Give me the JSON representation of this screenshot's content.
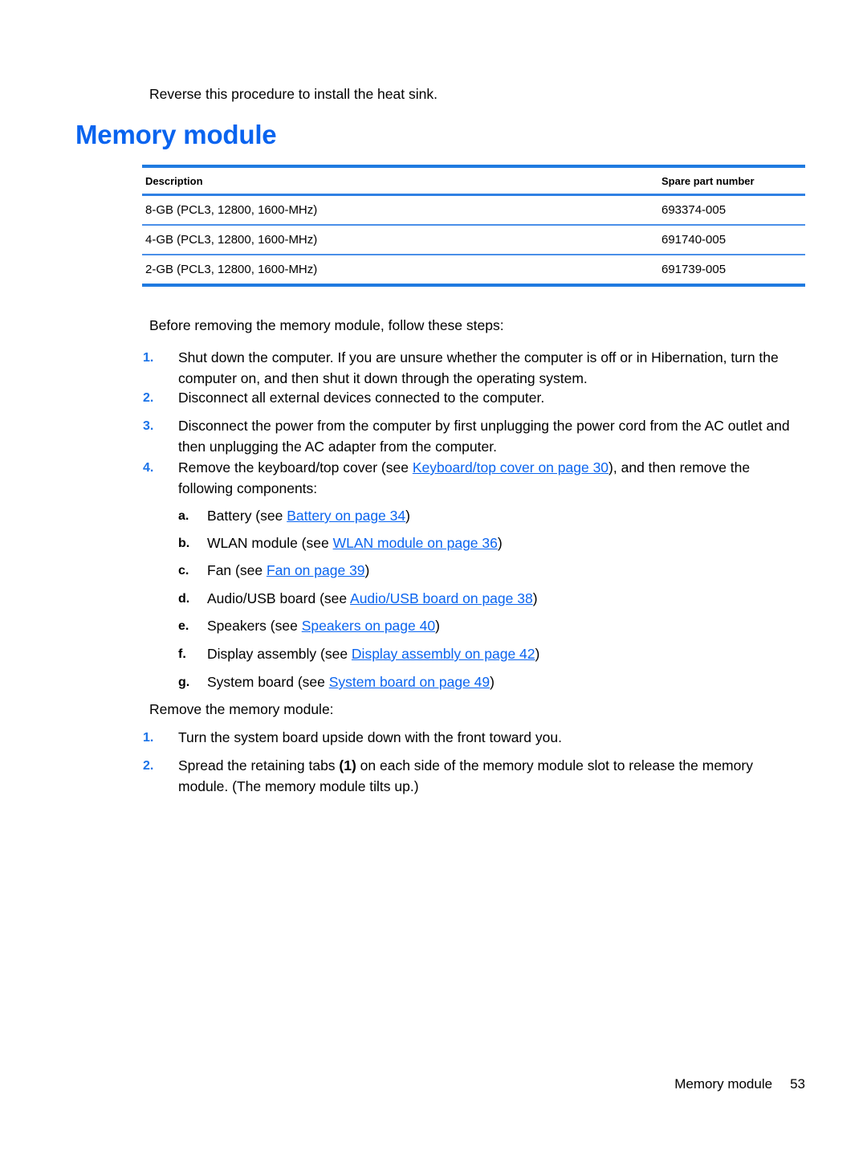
{
  "document": {
    "intro_line": "Reverse this procedure to install the heat sink.",
    "heading": "Memory module",
    "accent_color": "#0a64ef",
    "table_border_color": "#1f7ae0"
  },
  "parts_table": {
    "columns": [
      "Description",
      "Spare part number"
    ],
    "rows": [
      {
        "description": "8-GB (PCL3, 12800, 1600-MHz)",
        "spare_part_number": "693374-005"
      },
      {
        "description": "4-GB (PCL3, 12800, 1600-MHz)",
        "spare_part_number": "691740-005"
      },
      {
        "description": "2-GB (PCL3, 12800, 1600-MHz)",
        "spare_part_number": "691739-005"
      }
    ]
  },
  "before_section": {
    "lead_in": "Before removing the memory module, follow these steps:",
    "steps": [
      {
        "marker": "1.",
        "text": "Shut down the computer. If you are unsure whether the computer is off or in Hibernation, turn the computer on, and then shut it down through the operating system."
      },
      {
        "marker": "2.",
        "text": "Disconnect all external devices connected to the computer."
      },
      {
        "marker": "3.",
        "text": "Disconnect the power from the computer by first unplugging the power cord from the AC outlet and then unplugging the AC adapter from the computer."
      }
    ],
    "step4": {
      "marker": "4.",
      "text_before": "Remove the keyboard/top cover (see ",
      "link": "Keyboard/top cover on page 30",
      "text_after": "), and then remove the following components:"
    },
    "sub_steps": [
      {
        "marker": "a.",
        "text_before": "Battery (see ",
        "link": "Battery on page 34",
        "text_after": ")"
      },
      {
        "marker": "b.",
        "text_before": "WLAN module (see ",
        "link": "WLAN module on page 36",
        "text_after": ")"
      },
      {
        "marker": "c.",
        "text_before": "Fan (see ",
        "link": "Fan on page 39",
        "text_after": ")"
      },
      {
        "marker": "d.",
        "text_before": "Audio/USB board (see ",
        "link": "Audio/USB board on page 38",
        "text_after": ")"
      },
      {
        "marker": "e.",
        "text_before": "Speakers (see ",
        "link": "Speakers on page 40",
        "text_after": ")"
      },
      {
        "marker": "f.",
        "text_before": "Display assembly (see ",
        "link": "Display assembly on page 42",
        "text_after": ")"
      },
      {
        "marker": "g.",
        "text_before": "System board (see ",
        "link": "System board on page 49",
        "text_after": ")"
      }
    ]
  },
  "remove_section": {
    "lead_in": "Remove the memory module:",
    "step1": {
      "marker": "1.",
      "text": "Turn the system board upside down with the front toward you."
    },
    "step2": {
      "marker": "2.",
      "text_before": "Spread the retaining tabs ",
      "bold_ref": "(1)",
      "text_after": " on each side of the memory module slot to release the memory module. (The memory module tilts up.)"
    }
  },
  "footer": {
    "title": "Memory module",
    "page_number": "53"
  }
}
